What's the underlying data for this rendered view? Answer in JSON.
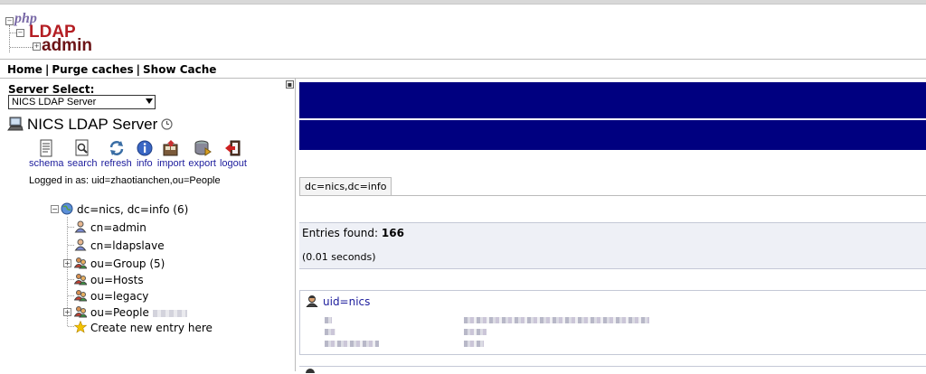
{
  "logo": {
    "alt": "phpLDAPadmin",
    "php": "php",
    "ldap": "LDAP",
    "admin": "admin"
  },
  "menu": {
    "home": "Home",
    "purge": "Purge caches",
    "show_cache": "Show Cache",
    "separator": "|"
  },
  "server": {
    "select_label": "Server Select:",
    "selected": "NICS LDAP Server",
    "name": "NICS LDAP Server",
    "actions": [
      "schema",
      "search",
      "refresh",
      "info",
      "import",
      "export",
      "logout"
    ],
    "logged_in": "Logged in as: uid=zhaotianchen,ou=People"
  },
  "tree": {
    "root": "dc=nics, dc=info (6)",
    "children": [
      "cn=admin",
      "cn=ldapslave",
      "ou=Group (5)",
      "ou=Hosts",
      "ou=legacy",
      "ou=People"
    ],
    "create": "Create new entry here"
  },
  "right": {
    "dn_tab": "dc=nics,dc=info",
    "entries_label": "Entries found:",
    "entries_count": "166",
    "seconds": "(0.01 seconds)",
    "first_entry": "uid=nics"
  },
  "colors": {
    "banner": "#000080",
    "link": "#1c1c9c",
    "results_bg": "#eef0f6"
  }
}
